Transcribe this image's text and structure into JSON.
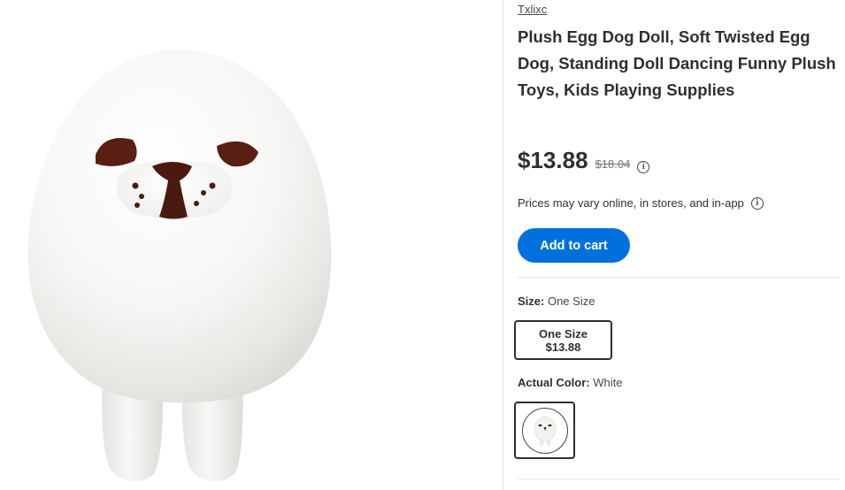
{
  "product": {
    "brand": "Txlixc",
    "title": "Plush Egg Dog Doll, Soft Twisted Egg Dog, Standing Doll Dancing Funny Plush Toys, Kids Playing Supplies",
    "image_icon": "plush-egg-dog-image"
  },
  "pricing": {
    "current_price": "$13.88",
    "was_price": "$18.04",
    "info_glyph": "i",
    "disclaimer": "Prices may vary online, in stores, and in-app"
  },
  "actions": {
    "add_to_cart_label": "Add to cart",
    "add_to_cart_color": "#0071dc"
  },
  "variants": {
    "size": {
      "label": "Size:",
      "selected": "One Size",
      "options": [
        {
          "name": "One Size",
          "price": "$13.88"
        }
      ]
    },
    "color": {
      "label": "Actual Color:",
      "selected": "White",
      "swatch_icon": "white-egg-dog-thumbnail"
    }
  }
}
